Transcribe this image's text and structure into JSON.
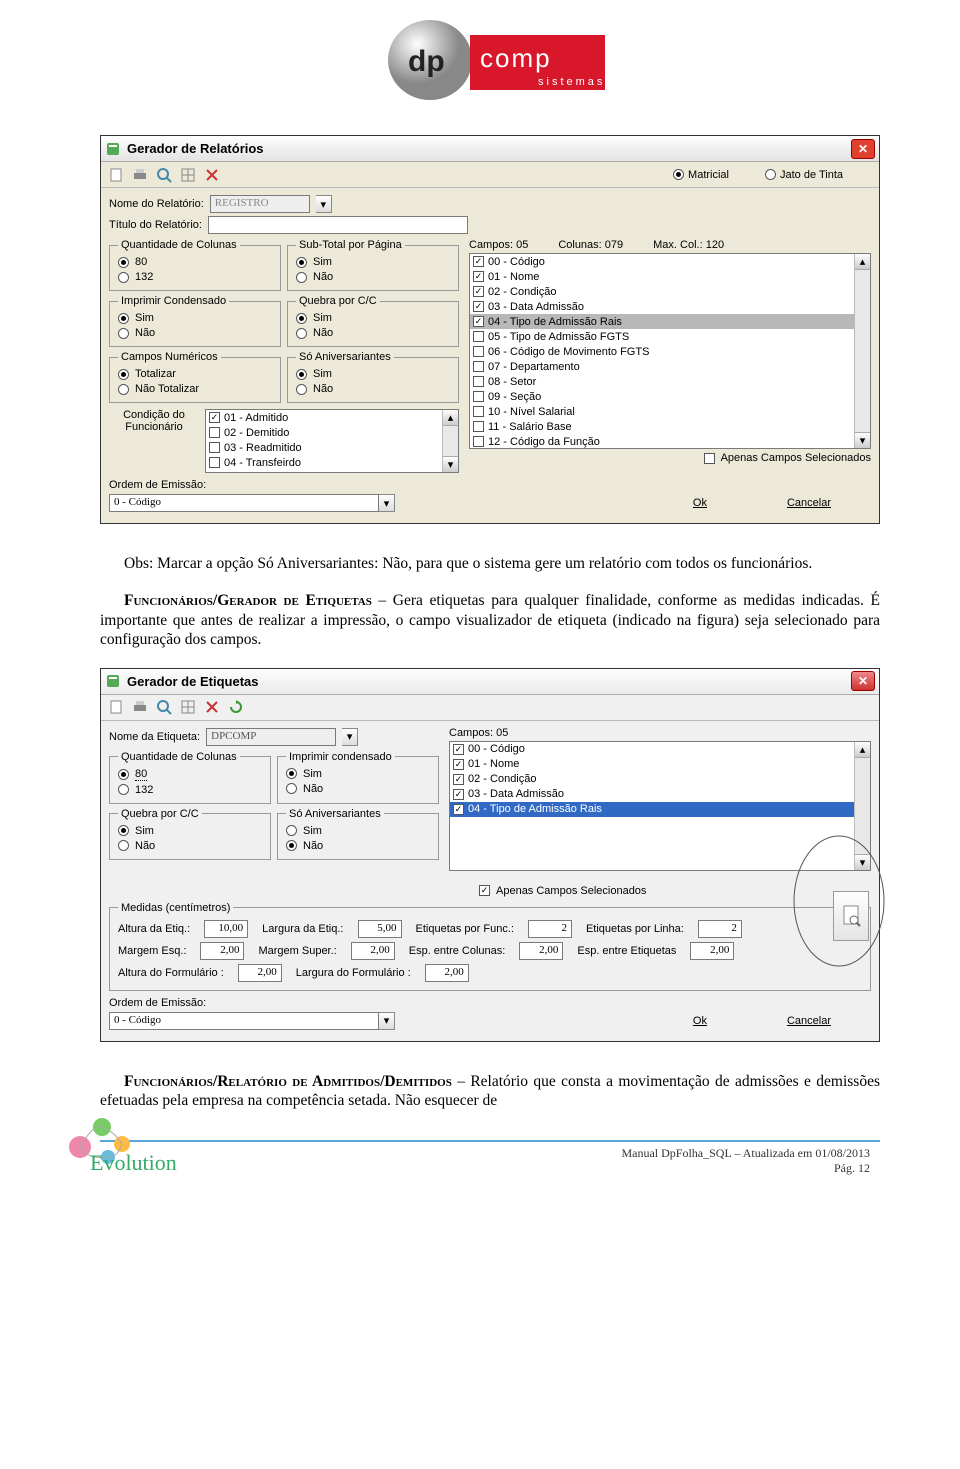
{
  "logo": {
    "brand_left": "dp",
    "brand_right": "comp",
    "sub": "sistemas"
  },
  "screenshot1": {
    "title": "Gerador de Relatórios",
    "print_mode": {
      "opt1": "Matricial",
      "opt2": "Jato de Tinta"
    },
    "nome_label": "Nome do Relatório:",
    "nome_value": "REGISTRO",
    "titulo_label": "Título do Relatório:",
    "fs_cols": {
      "legend": "Quantidade de Colunas",
      "a": "80",
      "b": "132"
    },
    "fs_sub": {
      "legend": "Sub-Total por Página",
      "a": "Sim",
      "b": "Não"
    },
    "fs_cond": {
      "legend": "Imprimir Condensado",
      "a": "Sim",
      "b": "Não"
    },
    "fs_queb": {
      "legend": "Quebra por C/C",
      "a": "Sim",
      "b": "Não"
    },
    "fs_num": {
      "legend": "Campos Numéricos",
      "a": "Totalizar",
      "b": "Não Totalizar"
    },
    "fs_aniv": {
      "legend": "Só Aniversariantes",
      "a": "Sim",
      "b": "Não"
    },
    "info": {
      "campos": "Campos: 05",
      "colunas": "Colunas: 079",
      "max": "Max. Col.: 120"
    },
    "fields": [
      {
        "chk": true,
        "t": "00 - Código"
      },
      {
        "chk": true,
        "t": "01 - Nome"
      },
      {
        "chk": true,
        "t": "02 - Condição"
      },
      {
        "chk": true,
        "t": "03 - Data Admissão"
      },
      {
        "chk": true,
        "t": "04 - Tipo de Admissão Rais",
        "sel": true
      },
      {
        "chk": false,
        "t": "05 - Tipo de Admissão FGTS"
      },
      {
        "chk": false,
        "t": "06 - Código  de Movimento FGTS"
      },
      {
        "chk": false,
        "t": "07 - Departamento"
      },
      {
        "chk": false,
        "t": "08 - Setor"
      },
      {
        "chk": false,
        "t": "09 - Seção"
      },
      {
        "chk": false,
        "t": "10 - Nível Salarial"
      },
      {
        "chk": false,
        "t": "11 - Salário Base"
      },
      {
        "chk": false,
        "t": "12 - Código da Função"
      }
    ],
    "apenas_sel": "Apenas Campos Selecionados",
    "cond_label": "Condição do\nFuncionário",
    "cond_list": [
      {
        "chk": true,
        "t": "01 - Admitido"
      },
      {
        "chk": false,
        "t": "02 - Demitido"
      },
      {
        "chk": false,
        "t": "03 - Readmitido"
      },
      {
        "chk": false,
        "t": "04 - Transfeirdo"
      }
    ],
    "ordem_label": "Ordem de Emissão:",
    "ordem_value": "0 - Código",
    "ok": "Ok",
    "cancel": "Cancelar"
  },
  "para1": "Obs: Marcar a opção Só Aniversariantes: Não, para que o sistema gere um relatório com todos os funcionários.",
  "para2_head": "Funcionários/Gerador de Etiquetas",
  "para2_body": " – Gera etiquetas para qualquer finalidade, conforme as medidas indicadas. É importante que antes de realizar a impressão, o campo visualizador de etiqueta (indicado na figura) seja selecionado para configuração dos campos.",
  "screenshot2": {
    "title": "Gerador de Etiquetas",
    "nome_label": "Nome da Etiqueta:",
    "nome_value": "DPCOMP",
    "fs_cols": {
      "legend": "Quantidade de Colunas",
      "a": "80",
      "b": "132"
    },
    "fs_cond": {
      "legend": "Imprimir condensado",
      "a": "Sim",
      "b": "Não"
    },
    "fs_queb": {
      "legend": "Quebra por C/C",
      "a": "Sim",
      "b": "Não"
    },
    "fs_aniv": {
      "legend": "Só Aniversariantes",
      "a": "Sim",
      "b": "Não"
    },
    "info": {
      "campos": "Campos: 05"
    },
    "fields": [
      {
        "chk": true,
        "t": "00 - Código"
      },
      {
        "chk": true,
        "t": "01 - Nome"
      },
      {
        "chk": true,
        "t": "02 - Condição"
      },
      {
        "chk": true,
        "t": "03 - Data Admissão"
      },
      {
        "chk": true,
        "t": "04 - Tipo de Admissão Rais",
        "selblue": true
      }
    ],
    "apenas_sel": "Apenas Campos Selecionados",
    "meas_legend": "Medidas (centímetros)",
    "meas": {
      "alt_etiq_l": "Altura da Etiq.:",
      "alt_etiq_v": "10,00",
      "larg_etiq_l": "Largura da Etiq.:",
      "larg_etiq_v": "5,00",
      "etiq_func_l": "Etiquetas por Func.:",
      "etiq_func_v": "2",
      "etiq_linha_l": "Etiquetas por Linha:",
      "etiq_linha_v": "2",
      "marg_esq_l": "Margem Esq.:",
      "marg_esq_v": "2,00",
      "marg_sup_l": "Margem Super.:",
      "marg_sup_v": "2,00",
      "esp_col_l": "Esp. entre Colunas:",
      "esp_col_v": "2,00",
      "esp_etiq_l": "Esp. entre Etiquetas",
      "esp_etiq_v": "2,00",
      "alt_form_l": "Altura do Formulário :",
      "alt_form_v": "2,00",
      "larg_form_l": "Largura do Formulário :",
      "larg_form_v": "2,00"
    },
    "ordem_label": "Ordem de Emissão:",
    "ordem_value": "0 - Código",
    "ok": "Ok",
    "cancel": "Cancelar"
  },
  "para3_head": "Funcionários/Relatório de Admitidos/Demitidos",
  "para3_body": " – Relatório que consta a movimentação de admissões e demissões efetuadas pela empresa na competência setada. Não esquecer de",
  "footer": {
    "line1": "Manual DpFolha_SQL – Atualizada em 01/08/2013",
    "line2": "Pág. 12"
  }
}
